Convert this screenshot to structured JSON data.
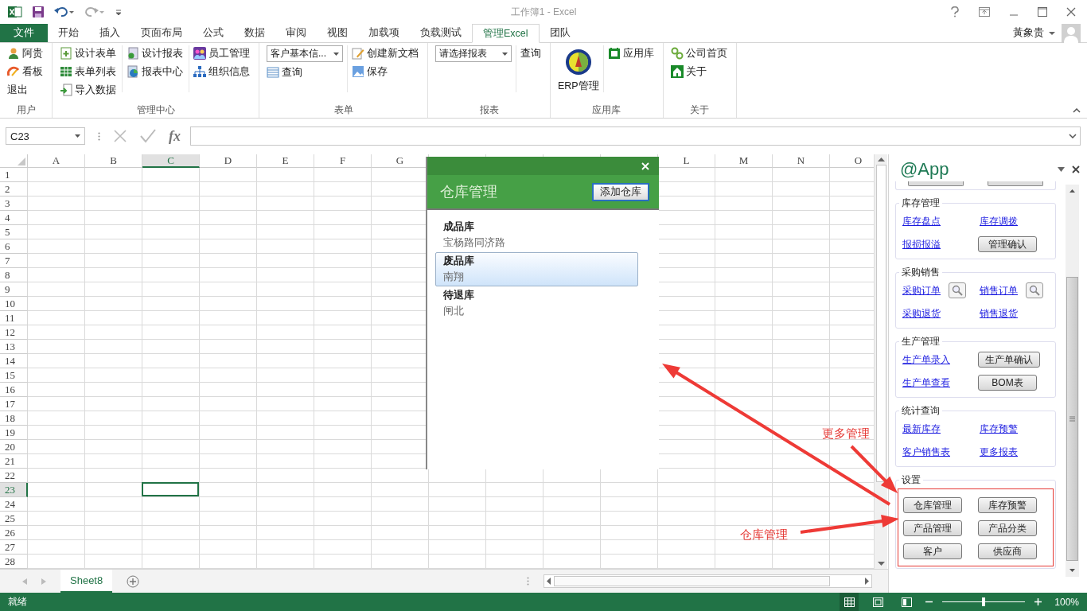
{
  "window": {
    "title": "工作簿1 - Excel",
    "user": "黃象贵"
  },
  "tabs": [
    {
      "label": "文件",
      "kind": "file",
      "selected": false
    },
    {
      "label": "开始",
      "kind": "tab",
      "selected": false
    },
    {
      "label": "插入",
      "kind": "tab",
      "selected": false
    },
    {
      "label": "页面布局",
      "kind": "tab",
      "selected": false
    },
    {
      "label": "公式",
      "kind": "tab",
      "selected": false
    },
    {
      "label": "数据",
      "kind": "tab",
      "selected": false
    },
    {
      "label": "审阅",
      "kind": "tab",
      "selected": false
    },
    {
      "label": "视图",
      "kind": "tab",
      "selected": false
    },
    {
      "label": "加载项",
      "kind": "tab",
      "selected": false
    },
    {
      "label": "负载测试",
      "kind": "tab",
      "selected": false
    },
    {
      "label": "管理Excel",
      "kind": "tab",
      "selected": true
    },
    {
      "label": "团队",
      "kind": "tab",
      "selected": false
    }
  ],
  "ribbon": [
    {
      "label": "用户",
      "columns": [
        [
          {
            "kind": "button",
            "label": "阿贵"
          },
          {
            "kind": "button",
            "label": "看板"
          },
          {
            "kind": "text",
            "label": "退出"
          }
        ]
      ]
    },
    {
      "label": "管理中心",
      "columns": [
        [
          {
            "kind": "button",
            "label": "设计表单"
          },
          {
            "kind": "button",
            "label": "表单列表"
          },
          {
            "kind": "button",
            "label": "导入数据"
          }
        ],
        [
          {
            "kind": "button",
            "label": "设计报表"
          },
          {
            "kind": "button",
            "label": "报表中心"
          }
        ],
        [
          {
            "kind": "button",
            "label": "员工管理"
          },
          {
            "kind": "button",
            "label": "组织信息"
          }
        ]
      ]
    },
    {
      "label": "表单",
      "columns": [
        [
          {
            "kind": "dropdown",
            "value": "客户基本信..."
          },
          {
            "kind": "button",
            "label": "查询"
          }
        ],
        [
          {
            "kind": "button",
            "label": "创建新文档"
          },
          {
            "kind": "button",
            "label": "保存"
          }
        ]
      ]
    },
    {
      "label": "报表",
      "columns": [
        [
          {
            "kind": "dropdown",
            "value": "请选择报表"
          }
        ],
        [
          {
            "kind": "text",
            "label": "查询"
          }
        ]
      ]
    },
    {
      "label": "应用库",
      "columns": [
        [
          {
            "kind": "large",
            "label": "ERP管理"
          }
        ],
        [
          {
            "kind": "button",
            "label": "应用库"
          }
        ]
      ]
    },
    {
      "label": "关于",
      "columns": [
        [
          {
            "kind": "button",
            "label": "公司首页"
          },
          {
            "kind": "button",
            "label": "关于"
          }
        ]
      ]
    }
  ],
  "formula_bar": {
    "name_box": "C23",
    "function_label": "fx"
  },
  "sheet": {
    "columns": [
      {
        "label": "A",
        "selected": false
      },
      {
        "label": "B",
        "selected": false
      },
      {
        "label": "C",
        "selected": true
      },
      {
        "label": "D",
        "selected": false
      },
      {
        "label": "E",
        "selected": false
      },
      {
        "label": "F",
        "selected": false
      },
      {
        "label": "G",
        "selected": false
      },
      {
        "selected": false
      },
      {
        "selected": false
      },
      {
        "selected": false
      },
      {
        "selected": false
      },
      {
        "label": "L",
        "selected": false
      },
      {
        "label": "M",
        "selected": false
      },
      {
        "label": "N",
        "selected": false
      },
      {
        "label": "O",
        "selected": false
      }
    ],
    "rows": [
      {
        "label": "1",
        "selected": false
      },
      {
        "label": "2",
        "selected": false
      },
      {
        "label": "3",
        "selected": false
      },
      {
        "label": "4",
        "selected": false
      },
      {
        "label": "5",
        "selected": false
      },
      {
        "label": "6",
        "selected": false
      },
      {
        "label": "7",
        "selected": false
      },
      {
        "label": "8",
        "selected": false
      },
      {
        "label": "9",
        "selected": false
      },
      {
        "label": "10",
        "selected": false
      },
      {
        "label": "11",
        "selected": false
      },
      {
        "label": "12",
        "selected": false
      },
      {
        "label": "13",
        "selected": false
      },
      {
        "label": "14",
        "selected": false
      },
      {
        "label": "15",
        "selected": false
      },
      {
        "label": "16",
        "selected": false
      },
      {
        "label": "17",
        "selected": false
      },
      {
        "label": "18",
        "selected": false
      },
      {
        "label": "19",
        "selected": false
      },
      {
        "label": "20",
        "selected": false
      },
      {
        "label": "21",
        "selected": false
      },
      {
        "label": "22",
        "selected": false
      },
      {
        "label": "23",
        "selected": true
      },
      {
        "label": "24",
        "selected": false
      },
      {
        "label": "25",
        "selected": false
      },
      {
        "label": "26",
        "selected": false
      },
      {
        "label": "27",
        "selected": false
      },
      {
        "label": "28",
        "selected": false
      }
    ],
    "sheet_tabs": [
      {
        "label": "Sheet8",
        "selected": true
      }
    ]
  },
  "dialog": {
    "title": "仓库管理",
    "add_button": "添加仓库",
    "items": [
      {
        "name": "成品库",
        "address": "宝杨路同济路",
        "selected": false
      },
      {
        "name": "废品库",
        "address": "南翔",
        "selected": true
      },
      {
        "name": "待退库",
        "address": "闸北",
        "selected": false
      }
    ]
  },
  "task_pane": {
    "title": "@App",
    "sections": [
      {
        "title": "库存管理",
        "highlighted": false,
        "items": [
          {
            "kind": "link",
            "label": "库存盘点"
          },
          {
            "kind": "link",
            "label": "库存调拨"
          },
          {
            "kind": "link",
            "label": "报损报溢"
          },
          {
            "kind": "button",
            "label": "管理确认"
          }
        ]
      },
      {
        "title": "采购销售",
        "highlighted": false,
        "items": [
          {
            "kind": "link",
            "label": "采购订单",
            "search_button": true
          },
          {
            "kind": "link",
            "label": "销售订单",
            "search_button": true
          },
          {
            "kind": "link",
            "label": "采购退货",
            "search_button": false
          },
          {
            "kind": "link",
            "label": "销售退货",
            "search_button": false
          }
        ]
      },
      {
        "title": "生产管理",
        "highlighted": false,
        "items": [
          {
            "kind": "link",
            "label": "生产单录入"
          },
          {
            "kind": "button",
            "label": "生产单确认"
          },
          {
            "kind": "link",
            "label": "生产单查看"
          },
          {
            "kind": "button",
            "label": "BOM表"
          }
        ]
      },
      {
        "title": "统计查询",
        "highlighted": false,
        "items": [
          {
            "kind": "link",
            "label": "最新库存"
          },
          {
            "kind": "link",
            "label": "库存预警"
          },
          {
            "kind": "link",
            "label": "客户销售表"
          },
          {
            "kind": "link",
            "label": "更多报表"
          }
        ]
      },
      {
        "title": "设置",
        "highlighted": true,
        "items": [
          {
            "kind": "button",
            "label": "仓库管理"
          },
          {
            "kind": "button",
            "label": "库存预警"
          },
          {
            "kind": "button",
            "label": "产品管理"
          },
          {
            "kind": "button",
            "label": "产品分类"
          },
          {
            "kind": "button",
            "label": "客户"
          },
          {
            "kind": "button",
            "label": "供应商"
          }
        ]
      }
    ]
  },
  "annotations": [
    {
      "label": "更多管理"
    },
    {
      "label": "仓库管理"
    }
  ],
  "status_bar": {
    "status": "就绪",
    "zoom": {
      "level": 0.5,
      "reading": "100%"
    }
  }
}
